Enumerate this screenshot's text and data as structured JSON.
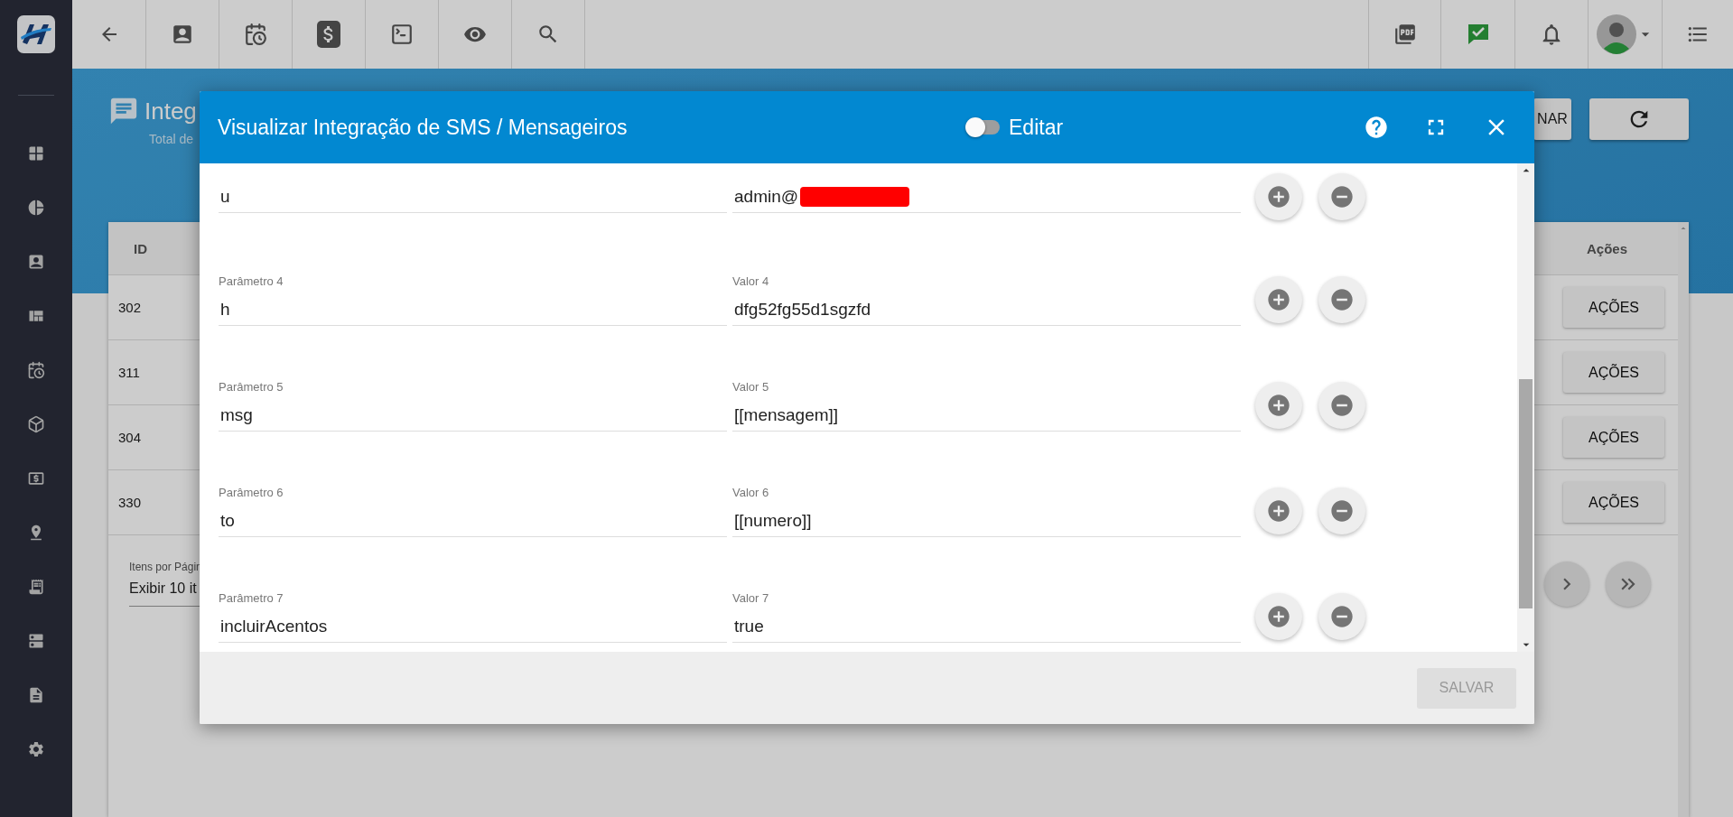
{
  "page": {
    "title": "Integ",
    "subtitle": "Total de",
    "header_button": "NAR"
  },
  "table": {
    "columns": [
      "ID",
      "Ações"
    ],
    "rows": [
      {
        "id": "302",
        "action": "AÇÕES"
      },
      {
        "id": "311",
        "action": "AÇÕES"
      },
      {
        "id": "304",
        "action": "AÇÕES"
      },
      {
        "id": "330",
        "action": "AÇÕES"
      }
    ]
  },
  "pagination": {
    "label": "Itens por Págin",
    "value": "Exibir 10 it"
  },
  "modal": {
    "title": "Visualizar Integração de SMS / Mensageiros",
    "edit_toggle": {
      "label": "Editar",
      "on": false
    },
    "params": [
      {
        "param_value": "u",
        "value": "admin@",
        "redacted": true
      },
      {
        "param_label": "Parâmetro 4",
        "param_value": "h",
        "value_label": "Valor 4",
        "value": "dfg52fg55d1sgzfd",
        "redacted": false
      },
      {
        "param_label": "Parâmetro 5",
        "param_value": "msg",
        "value_label": "Valor 5",
        "value": "[[mensagem]]",
        "redacted": false
      },
      {
        "param_label": "Parâmetro 6",
        "param_value": "to",
        "value_label": "Valor 6",
        "value": "[[numero]]",
        "redacted": false
      },
      {
        "param_label": "Parâmetro 7",
        "param_value": "incluirAcentos",
        "value_label": "Valor 7",
        "value": "true",
        "redacted": false
      }
    ],
    "save_button": {
      "label": "SALVAR",
      "disabled": true
    }
  }
}
